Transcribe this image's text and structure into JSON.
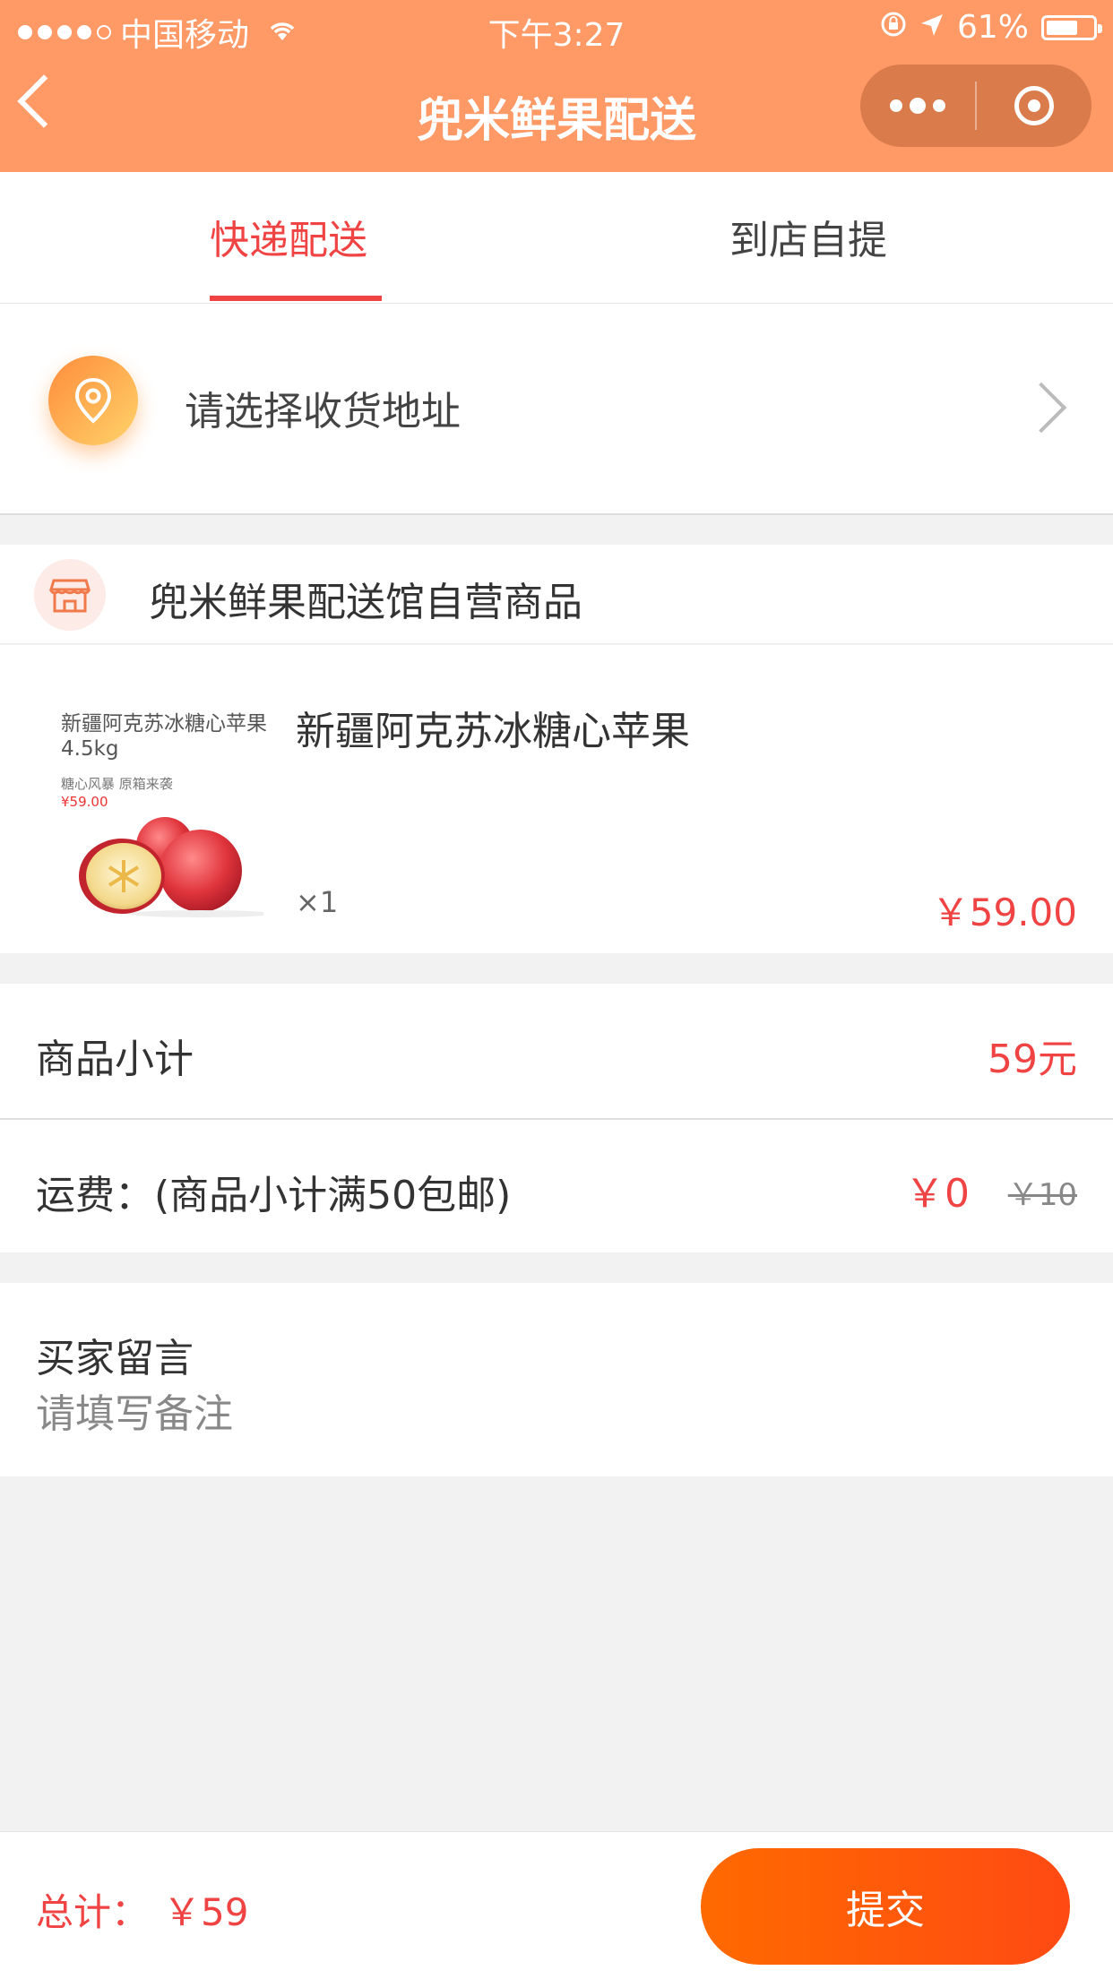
{
  "status_bar": {
    "carrier": "中国移动",
    "time": "下午3:27",
    "battery": "61%"
  },
  "nav": {
    "title": "兜米鲜果配送"
  },
  "tabs": [
    {
      "label": "快递配送",
      "active": true
    },
    {
      "label": "到店自提",
      "active": false
    }
  ],
  "address": {
    "prompt": "请选择收货地址"
  },
  "store": {
    "name": "兜米鲜果配送馆自营商品"
  },
  "product": {
    "name": "新疆阿克苏冰糖心苹果",
    "quantity": "×1",
    "price": "￥59.00",
    "image_text": {
      "title": "新疆阿克苏冰糖心苹果4.5kg",
      "subtitle": "糖心风暴 原箱来袭",
      "price": "¥59.00"
    }
  },
  "summary": {
    "subtotal_label": "商品小计",
    "subtotal_value": "59元",
    "shipping_label": "运费：(商品小计满50包邮)",
    "shipping_value": "￥0",
    "shipping_original": "￥10"
  },
  "message": {
    "title": "买家留言",
    "placeholder": "请填写备注"
  },
  "footer": {
    "total_label": "总计：",
    "total_value": "￥59",
    "submit_label": "提交"
  },
  "colors": {
    "header": "#ff9966",
    "accent_red": "#f04343",
    "submit_gradient_start": "#ff6a00",
    "submit_gradient_end": "#ff4a13"
  }
}
